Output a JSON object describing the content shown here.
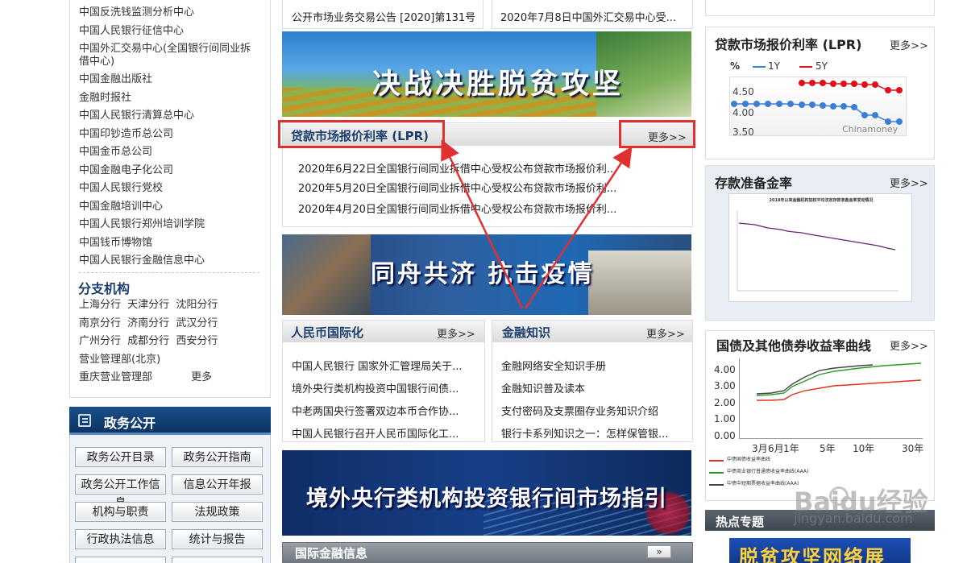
{
  "left": {
    "institutions": [
      "中国反洗钱监测分析中心",
      "中国人民银行征信中心",
      "中国外汇交易中心(全国银行间同业拆",
      "借中心)",
      "中国金融出版社",
      "金融时报社",
      "中国人民银行清算总中心",
      "中国印钞造币总公司",
      "中国金币总公司",
      "中国金融电子化公司",
      "中国人民银行党校",
      "中国金融培训中心",
      "中国人民银行郑州培训学院",
      "中国钱币博物馆",
      "中国人民银行金融信息中心"
    ],
    "branch_heading": "分支机构",
    "branch_rows": [
      [
        "上海分行",
        "天津分行",
        "沈阳分行"
      ],
      [
        "南京分行",
        "济南分行",
        "武汉分行"
      ],
      [
        "广州分行",
        "成都分行",
        "西安分行"
      ]
    ],
    "branch_extra_1": "营业管理部(北京)",
    "branch_extra_2": "重庆营业管理部",
    "branch_more": "更多",
    "gov_title": "政务公开",
    "gov_buttons": [
      "政务公开目录",
      "政务公开指南",
      "政务公开工作信息",
      "信息公开年报",
      "机构与职责",
      "法规政策",
      "行政执法信息",
      "统计与报告"
    ]
  },
  "middle": {
    "top_news": [
      "公开市场业务交易公告 [2020]第131号",
      "2020年7月8日中国外汇交易中心受..."
    ],
    "banner1_text": "决战决胜脱贫攻坚",
    "lpr": {
      "title": "贷款市场报价利率 (LPR)",
      "more": "更多>>",
      "items": [
        "2020年6月22日全国银行间同业拆借中心受权公布贷款市场报价利...",
        "2020年5月20日全国银行间同业拆借中心受权公布贷款市场报价利...",
        "2020年4月20日全国银行间同业拆借中心受权公布贷款市场报价利..."
      ]
    },
    "banner2_text": "同舟共济 抗击疫情",
    "rmb": {
      "title": "人民币国际化",
      "more": "更多>>",
      "items": [
        "中国人民银行 国家外汇管理局关于...",
        "境外央行类机构投资中国银行间债...",
        "中老两国央行签署双边本币合作协...",
        "中国人民银行召开人民币国际化工..."
      ]
    },
    "fin": {
      "title": "金融知识",
      "more": "更多>>",
      "items": [
        "金融网络安全知识手册",
        "金融知识普及读本",
        "支付密码及支票圈存业务知识介绍",
        "银行卡系列知识之一：怎样保管银..."
      ]
    },
    "banner3_text": "境外央行类机构投资银行间市场指引",
    "intl_title": "国际金融信息",
    "intl_more": "»"
  },
  "right": {
    "lpr_title": "贷款市场报价利率 (LPR)",
    "lpr_more": "更多>>",
    "lpr_chart": {
      "unit": "%",
      "legend": [
        "1Y",
        "5Y"
      ],
      "yticks": [
        "4.50",
        "4.00",
        "3.50"
      ],
      "watermark": "Chinamoney",
      "colors": {
        "1Y": "#3a7fd5",
        "5Y": "#e0101a"
      }
    },
    "rrr_title": "存款准备金率",
    "rrr_more": "更多>>",
    "rrr_chart_title": "2018年以来金融机构加权平均法定存款准备金率变动情况",
    "bond_title": "国债及其他债券收益率曲线",
    "bond_more": "更多>>",
    "bond_chart": {
      "yticks": [
        "4.00",
        "3.00",
        "2.00",
        "1.00",
        "0.00"
      ],
      "xticks": [
        "3月",
        "6月",
        "1年",
        "5年",
        "10年",
        "30年"
      ],
      "legend": [
        "中债国债收益率曲线",
        "中债商业银行普通债收益率曲线(AAA)",
        "中债中短期票据收益率曲线(AAA)"
      ],
      "colors": [
        "#e0301e",
        "#2a9a2a",
        "#444444"
      ]
    },
    "hot_title": "热点专题",
    "hot_banner": "脱贫攻坚网络展"
  },
  "watermark": {
    "brand": "Baidu经验",
    "url": "jingyan.baidu.com"
  }
}
